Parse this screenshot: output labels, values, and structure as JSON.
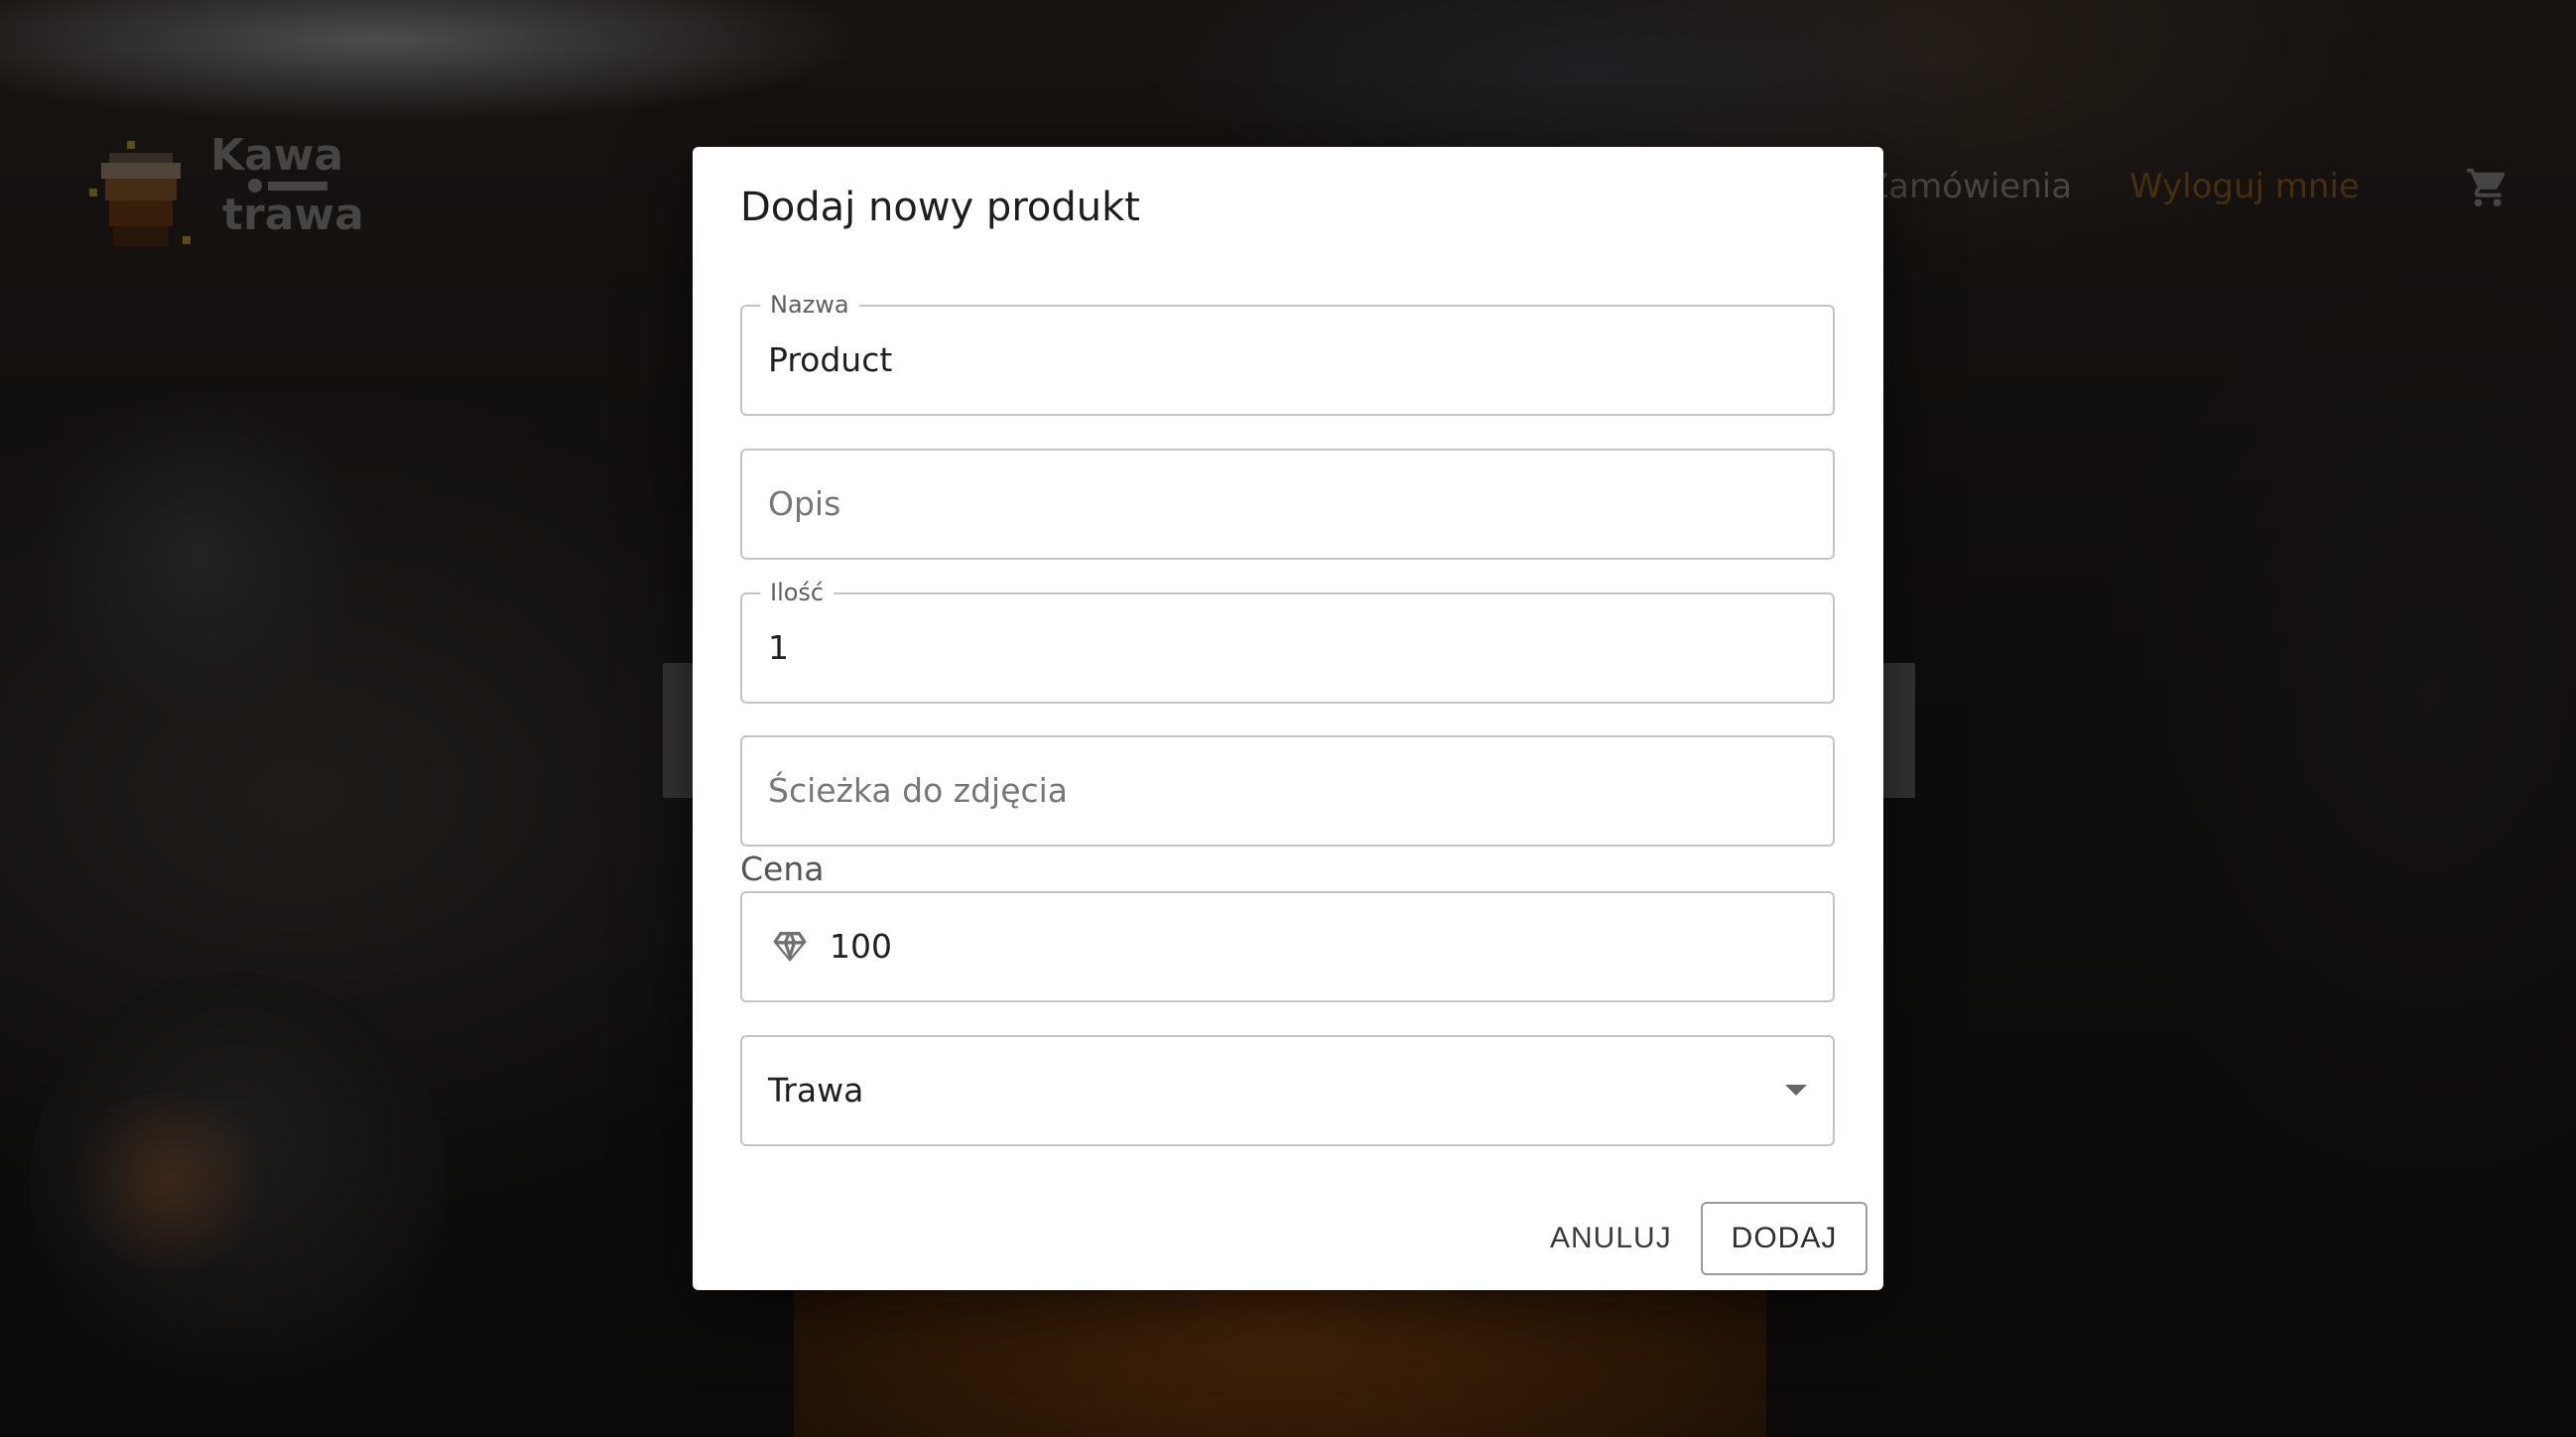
{
  "header": {
    "brand_line1": "Kawa",
    "brand_line2": "trawa",
    "nav_orders": "Zamówienia",
    "nav_logout": "Wyloguj mnie",
    "cart_icon": "shopping-cart-icon",
    "logout_color": "#8a5e1f"
  },
  "dialog": {
    "title": "Dodaj nowy produkt",
    "name_label": "Nazwa",
    "name_value": "Product",
    "description_placeholder": "Opis",
    "quantity_label": "Ilość",
    "quantity_value": "1",
    "image_path_placeholder": "Ścieżka do zdjęcia",
    "price_label": "Cena",
    "price_icon": "diamond-icon",
    "price_value": "100",
    "category_selected": "Trawa",
    "cancel_label": "ANULUJ",
    "add_label": "DODAJ"
  }
}
